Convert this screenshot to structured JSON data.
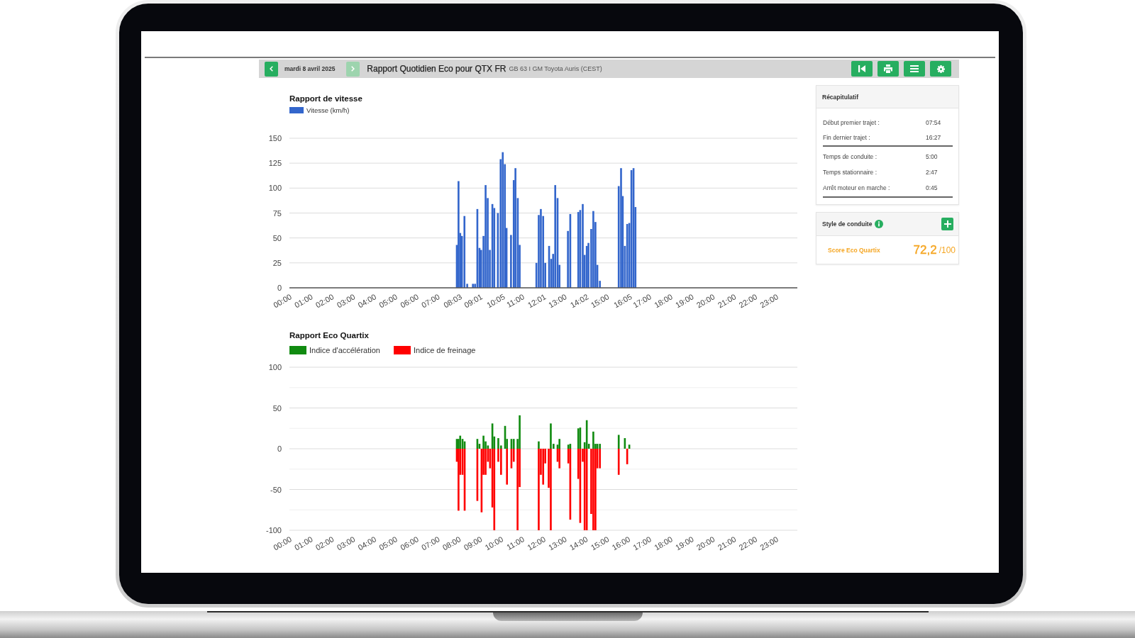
{
  "report_header": {
    "previous_button": {
      "disabled": false
    },
    "date": "mardi 8 avril 2025",
    "next_button": {
      "disabled": true
    },
    "title": "Rapport Quotidien Eco pour QTX FR",
    "subtitle": "GB 63 I GM Toyota Auris (CEST)",
    "action_buttons": [
      {
        "kind": "first"
      },
      {
        "kind": "print"
      },
      {
        "kind": "list"
      },
      {
        "kind": "settings"
      }
    ]
  },
  "speed_report": {
    "chart_data": {
      "type": "bar",
      "title": "Rapport de vitesse",
      "x": [
        7.91,
        7.99,
        8.07,
        8.15,
        8.27,
        8.4,
        8.67,
        8.77,
        8.88,
        8.98,
        9.06,
        9.17,
        9.27,
        9.37,
        9.47,
        9.59,
        9.68,
        9.85,
        9.98,
        10.08,
        10.18,
        10.26,
        10.47,
        10.6,
        10.68,
        10.79,
        10.88,
        11.67,
        11.78,
        11.88,
        11.99,
        12.09,
        12.27,
        12.37,
        12.46,
        12.56,
        12.67,
        12.76,
        13.16,
        13.27,
        13.65,
        13.74,
        13.86,
        13.95,
        14.05,
        14.13,
        14.26,
        14.36,
        14.46,
        14.55,
        14.67,
        15.56,
        15.67,
        15.75,
        15.85,
        15.96,
        16.06,
        16.16,
        16.26,
        16.35
      ],
      "series": [
        {
          "name": "Vitesse (km/h)",
          "color": "#3366cc",
          "values": [
            43,
            107,
            55,
            52,
            72,
            4,
            4,
            4,
            79,
            40,
            38,
            52,
            103,
            90,
            38,
            84,
            80,
            75,
            129,
            136,
            124,
            60,
            53,
            108,
            120,
            90,
            43,
            25,
            73,
            79,
            72,
            25,
            42,
            29,
            34,
            103,
            90,
            23,
            57,
            74,
            76,
            78,
            84,
            33,
            42,
            45,
            59,
            77,
            66,
            23,
            7,
            102,
            120,
            92,
            42,
            64,
            65,
            118,
            120,
            81
          ]
        }
      ],
      "xlim": [
        0,
        24
      ],
      "ylim": [
        0,
        150
      ],
      "xticks": [
        {
          "value": 0,
          "label": "00:00"
        },
        {
          "value": 1,
          "label": "01:00"
        },
        {
          "value": 2,
          "label": "02:00"
        },
        {
          "value": 3,
          "label": "03:00"
        },
        {
          "value": 4,
          "label": "04:00"
        },
        {
          "value": 5,
          "label": "05:00"
        },
        {
          "value": 6,
          "label": "06:00"
        },
        {
          "value": 7,
          "label": "07:00"
        },
        {
          "value": 8.05,
          "label": "08:03"
        },
        {
          "value": 9.02,
          "label": "09:01"
        },
        {
          "value": 10.08,
          "label": "10:05"
        },
        {
          "value": 11,
          "label": "11:00"
        },
        {
          "value": 12.02,
          "label": "12:01"
        },
        {
          "value": 13,
          "label": "13:00"
        },
        {
          "value": 14.03,
          "label": "14:02"
        },
        {
          "value": 15,
          "label": "15:00"
        },
        {
          "value": 16.08,
          "label": "16:05"
        },
        {
          "value": 17,
          "label": "17:00"
        },
        {
          "value": 18,
          "label": "18:00"
        },
        {
          "value": 19,
          "label": "19:00"
        },
        {
          "value": 20,
          "label": "20:00"
        },
        {
          "value": 21,
          "label": "21:00"
        },
        {
          "value": 22,
          "label": "22:00"
        },
        {
          "value": 23,
          "label": "23:00"
        }
      ],
      "yticks": [
        0,
        25,
        50,
        75,
        100,
        125,
        150
      ],
      "grid": true
    }
  },
  "eco_report": {
    "chart_data": {
      "type": "bar",
      "title": "Rapport Eco Quartix",
      "x": [
        7.91,
        7.99,
        8.07,
        8.18,
        8.28,
        8.88,
        8.98,
        9.08,
        9.17,
        9.27,
        9.38,
        9.48,
        9.59,
        9.68,
        9.87,
        10.0,
        10.19,
        10.28,
        10.49,
        10.6,
        10.78,
        10.88,
        11.78,
        11.88,
        11.99,
        12.09,
        12.25,
        12.35,
        12.48,
        12.67,
        12.76,
        13.18,
        13.27,
        13.65,
        13.74,
        13.86,
        13.95,
        14.05,
        14.15,
        14.26,
        14.36,
        14.46,
        14.55,
        14.67,
        15.56,
        15.85,
        15.96,
        16.06
      ],
      "series": [
        {
          "name": "Indice d'accélération",
          "color": "#118b11",
          "values": [
            12,
            12,
            16,
            12,
            9,
            12,
            6,
            null,
            16,
            9,
            4,
            null,
            31,
            15,
            13,
            4,
            28,
            12,
            12,
            12,
            12,
            41,
            9,
            null,
            null,
            null,
            null,
            31,
            6,
            5,
            12,
            5,
            6,
            25,
            26,
            null,
            8,
            35,
            6,
            null,
            21,
            6,
            6,
            6,
            17,
            13,
            null,
            5
          ]
        },
        {
          "name": "Indice de freinage",
          "color": "#ff0000",
          "values": [
            -16,
            -76,
            -32,
            -32,
            -76,
            -64,
            null,
            -78,
            -32,
            -32,
            -16,
            -24,
            -72,
            -100,
            -16,
            -32,
            null,
            -44,
            -24,
            -16,
            -100,
            -47,
            -100,
            -32,
            -44,
            -18,
            -48,
            -100,
            null,
            -16,
            -24,
            -18,
            -87,
            -37,
            -91,
            -16,
            -100,
            -100,
            null,
            -80,
            -100,
            -100,
            -24,
            -24,
            -32,
            null,
            -19,
            null
          ]
        }
      ],
      "xlim": [
        0,
        24
      ],
      "ylim": [
        -100,
        100
      ],
      "xticks": [
        {
          "value": 0,
          "label": "00:00"
        },
        {
          "value": 1,
          "label": "01:00"
        },
        {
          "value": 2,
          "label": "02:00"
        },
        {
          "value": 3,
          "label": "03:00"
        },
        {
          "value": 4,
          "label": "04:00"
        },
        {
          "value": 5,
          "label": "05:00"
        },
        {
          "value": 6,
          "label": "06:00"
        },
        {
          "value": 7,
          "label": "07:00"
        },
        {
          "value": 8,
          "label": "08:00"
        },
        {
          "value": 9,
          "label": "09:00"
        },
        {
          "value": 10,
          "label": "10:00"
        },
        {
          "value": 11,
          "label": "11:00"
        },
        {
          "value": 12,
          "label": "12:00"
        },
        {
          "value": 13,
          "label": "13:00"
        },
        {
          "value": 14,
          "label": "14:00"
        },
        {
          "value": 15,
          "label": "15:00"
        },
        {
          "value": 16,
          "label": "16:00"
        },
        {
          "value": 17,
          "label": "17:00"
        },
        {
          "value": 18,
          "label": "18:00"
        },
        {
          "value": 19,
          "label": "19:00"
        },
        {
          "value": 20,
          "label": "20:00"
        },
        {
          "value": 21,
          "label": "21:00"
        },
        {
          "value": 22,
          "label": "22:00"
        },
        {
          "value": 23,
          "label": "23:00"
        }
      ],
      "yticks": [
        -100,
        -50,
        0,
        50,
        100
      ],
      "grid": true,
      "stacked": true
    }
  },
  "summary": {
    "title": "Récapitulatif",
    "sections": [
      {
        "rows": [
          {
            "label": "Début premier trajet :",
            "value": "07:54"
          },
          {
            "label": "Fin dernier trajet :",
            "value": "16:27"
          }
        ]
      },
      {
        "rows": [
          {
            "label": "Temps de conduite :",
            "value": "5:00"
          },
          {
            "label": "Temps stationnaire :",
            "value": "2:47"
          },
          {
            "label": "Arrêt moteur en marche :",
            "value": "0:45"
          }
        ]
      }
    ]
  },
  "driving_style": {
    "title": "Style de conduite",
    "score_label": "Score Eco Quartix",
    "score": "72,2",
    "score_max": "/100"
  }
}
